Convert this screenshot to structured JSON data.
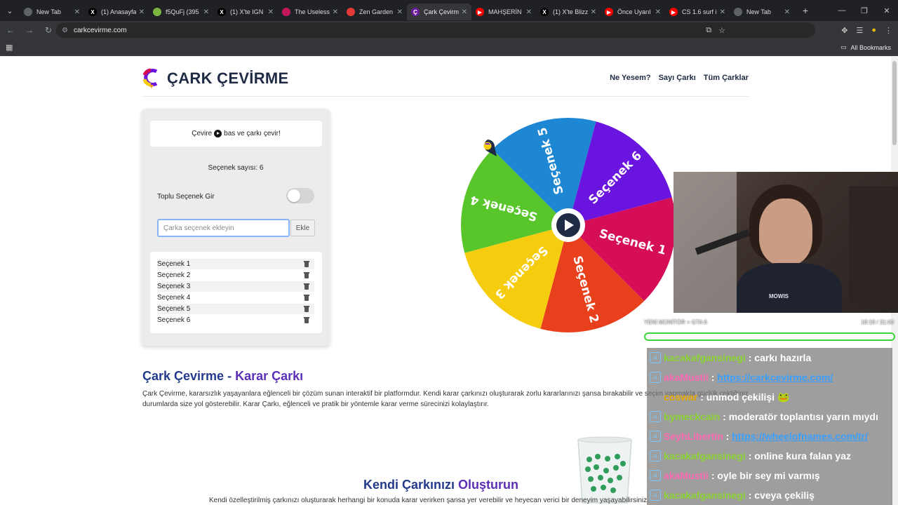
{
  "browser": {
    "tabs": [
      {
        "label": "New Tab",
        "icon_color": "#5f6368",
        "icon_char": ""
      },
      {
        "label": "(1) Anasayfa",
        "icon_color": "#000000",
        "icon_char": "X"
      },
      {
        "label": "f5QuFj (395",
        "icon_color": "#7cb342",
        "icon_char": ""
      },
      {
        "label": "(1) X'te IGN",
        "icon_color": "#000000",
        "icon_char": "X"
      },
      {
        "label": "The Useless",
        "icon_color": "#c2185b",
        "icon_char": ""
      },
      {
        "label": "Zen Garden",
        "icon_color": "#e53935",
        "icon_char": ""
      },
      {
        "label": "Çark Çevirme",
        "icon_color": "#6a1b9a",
        "icon_char": "Ç"
      },
      {
        "label": "MAHŞERİN",
        "icon_color": "#ff0000",
        "icon_char": "▶"
      },
      {
        "label": "(1) X'te Blizz",
        "icon_color": "#000000",
        "icon_char": "X"
      },
      {
        "label": "Önce Uyarıl",
        "icon_color": "#ff0000",
        "icon_char": "▶"
      },
      {
        "label": "CS 1.6 surf i",
        "icon_color": "#ff0000",
        "icon_char": "▶"
      },
      {
        "label": "New Tab",
        "icon_color": "#5f6368",
        "icon_char": ""
      }
    ],
    "active_tab_index": 6,
    "url": "carkcevirme.com",
    "all_bookmarks": "All Bookmarks"
  },
  "site": {
    "logo_text": "ÇARK ÇEVİRME",
    "nav": [
      "Ne Yesem?",
      "Sayı Çarkı",
      "Tüm Çarklar"
    ]
  },
  "panel": {
    "hint_before": "Çevire",
    "hint_after": "bas ve çarkı çevir!",
    "count_label": "Seçenek sayısı: 6",
    "bulk_label": "Toplu Seçenek Gir",
    "bulk_toggle_on": false,
    "input_placeholder": "Çarka seçenek ekleyin",
    "input_value": "",
    "add_button": "Ekle",
    "options": [
      "Seçenek 1",
      "Seçenek 2",
      "Seçenek 3",
      "Seçenek 4",
      "Seçenek 5",
      "Seçenek 6"
    ]
  },
  "wheel": {
    "segments": [
      {
        "label": "Seçenek 1",
        "color": "#d50e57"
      },
      {
        "label": "Seçenek 2",
        "color": "#e8401c"
      },
      {
        "label": "Seçenek 3",
        "color": "#f6cc0f"
      },
      {
        "label": "Seçenek 4",
        "color": "#58c52a"
      },
      {
        "label": "Seçenek 5",
        "color": "#1d87d4"
      },
      {
        "label": "Seçenek 6",
        "color": "#6a14e0"
      }
    ],
    "center_button_color": "#1f2a44"
  },
  "content": {
    "h2_main_a": "Çark Çevirme - ",
    "h2_main_b": "Karar Çarkı",
    "para": "Çark Çevirme, kararsızlık yaşayanlara eğlenceli bir çözüm sunan interaktif bir platformdur. Kendi karar çarkınızı oluşturarak zorlu kararlarınızı şansa bırakabilir ve seçim yapmakta güçlük çektiğiniz durumlarda size yol gösterebilir. Karar Çarkı, eğlenceli ve pratik bir yöntemle karar verme sürecinizi kolaylaştırır.",
    "h2_sub_a": "Kendi Çarkınızı ",
    "h2_sub_b": "Oluşturun",
    "para2": "Kendi özelleştirilmiş çarkınızı oluşturarak herhangi bir konuda karar verirken şansa yer verebilir ve heyecan verici bir deneyim yaşayabilirsiniz."
  },
  "stream": {
    "cam_tag": "MOWIS",
    "hud_left": "YENİ MONİTÖR + GTA 6",
    "hud_right": "18:19 / 31:00",
    "chat": [
      {
        "user": "kacakafgansinegi",
        "user_color": "#8bd332",
        "text": ": carkı hazırla",
        "link": false,
        "badge": true
      },
      {
        "user": "akaMustii",
        "user_color": "#ff69b4",
        "text": "https://carkcevirme.com/",
        "link": true,
        "badge": true
      },
      {
        "user": "coswar",
        "user_color": "#e6a900",
        "text": ": unmod çekilişi 🐸",
        "link": false,
        "badge": false
      },
      {
        "user": "bymeckcain",
        "user_color": "#8bd332",
        "text": ": moderatör toplantısı yarın mıydı",
        "link": false,
        "badge": true
      },
      {
        "user": "SeyhLibertin",
        "user_color": "#ff69b4",
        "text": "https://wheelofnames.com/tr/",
        "link": true,
        "badge": true
      },
      {
        "user": "kacakafgansinegi",
        "user_color": "#8bd332",
        "text": ": online kura falan yaz",
        "link": false,
        "badge": true
      },
      {
        "user": "akaMustii",
        "user_color": "#ff69b4",
        "text": ": oyle bir sey mi varmış",
        "link": false,
        "badge": true
      },
      {
        "user": "kacakafgansinegi",
        "user_color": "#8bd332",
        "text": ": cveya çekiliş",
        "link": false,
        "badge": true
      }
    ]
  }
}
